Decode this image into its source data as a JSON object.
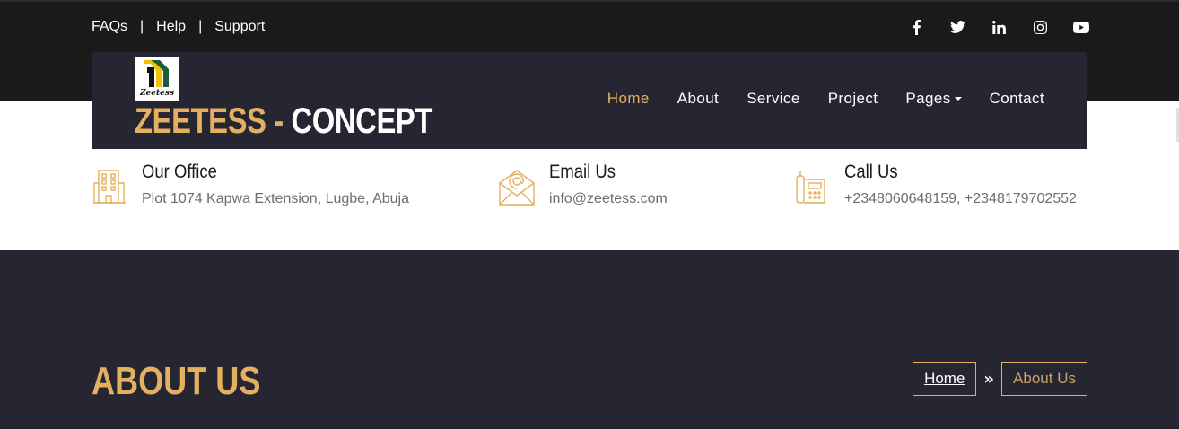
{
  "topbar": {
    "links": [
      "FAQs",
      "Help",
      "Support"
    ],
    "separator": "|",
    "social_icons": [
      "facebook-icon",
      "twitter-icon",
      "linkedin-icon",
      "instagram-icon",
      "youtube-icon"
    ]
  },
  "navbar": {
    "brand_part1": "ZEETESS",
    "brand_dash": " - ",
    "brand_part2": "CONCEPT",
    "logo_text": "Zeetess",
    "menu": [
      {
        "label": "Home",
        "active": true
      },
      {
        "label": "About"
      },
      {
        "label": "Service"
      },
      {
        "label": "Project"
      },
      {
        "label": "Pages",
        "dropdown": true
      },
      {
        "label": "Contact"
      }
    ]
  },
  "contact_info": [
    {
      "icon": "building-icon",
      "title": "Our Office",
      "text": "Plot 1074 Kapwa Extension, Lugbe, Abuja"
    },
    {
      "icon": "envelope-icon",
      "title": "Email Us",
      "text": "info@zeetess.com"
    },
    {
      "icon": "telephone-icon",
      "title": "Call Us",
      "text": "+2348060648159, +2348179702552"
    }
  ],
  "hero": {
    "title": "ABOUT US",
    "breadcrumb_home": "Home",
    "breadcrumb_separator": "»",
    "breadcrumb_current": "About Us"
  },
  "colors": {
    "accent": "#e4b05f",
    "dark_navy": "#262633",
    "topbar_bg": "#1a1a1a"
  }
}
